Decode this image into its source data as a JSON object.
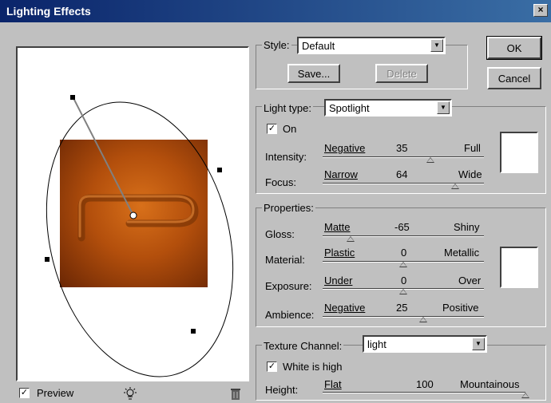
{
  "window": {
    "title": "Lighting Effects",
    "close": "×"
  },
  "style": {
    "label": "Style:",
    "value": "Default",
    "save": "Save...",
    "delete": "Delete"
  },
  "buttons": {
    "ok": "OK",
    "cancel": "Cancel"
  },
  "light_type": {
    "label": "Light type:",
    "value": "Spotlight",
    "on_label": "On",
    "on_checked": "✓",
    "intensity": {
      "label": "Intensity:",
      "min": "Negative",
      "value": "35",
      "max": "Full",
      "fraction": 0.67
    },
    "focus": {
      "label": "Focus:",
      "min": "Narrow",
      "value": "64",
      "max": "Wide",
      "fraction": 0.82
    },
    "color": "#ffffff"
  },
  "properties": {
    "title": "Properties:",
    "gloss": {
      "label": "Gloss:",
      "min": "Matte",
      "value": "-65",
      "max": "Shiny",
      "fraction": 0.175
    },
    "material": {
      "label": "Material:",
      "min": "Plastic",
      "value": "0",
      "max": "Metallic",
      "fraction": 0.5
    },
    "exposure": {
      "label": "Exposure:",
      "min": "Under",
      "value": "0",
      "max": "Over",
      "fraction": 0.5
    },
    "ambience": {
      "label": "Ambience:",
      "min": "Negative",
      "value": "25",
      "max": "Positive",
      "fraction": 0.625
    },
    "color": "#ffffff"
  },
  "texture": {
    "label": "Texture Channel:",
    "value": "light",
    "white_label": "White is high",
    "white_checked": "✓",
    "height": {
      "label": "Height:",
      "min": "Flat",
      "value": "100",
      "max": "Mountainous",
      "fraction": 1.0
    }
  },
  "preview": {
    "label": "Preview",
    "checked": "✓",
    "light_icon": "lightbulb-icon",
    "trash_icon": "trash-icon"
  }
}
